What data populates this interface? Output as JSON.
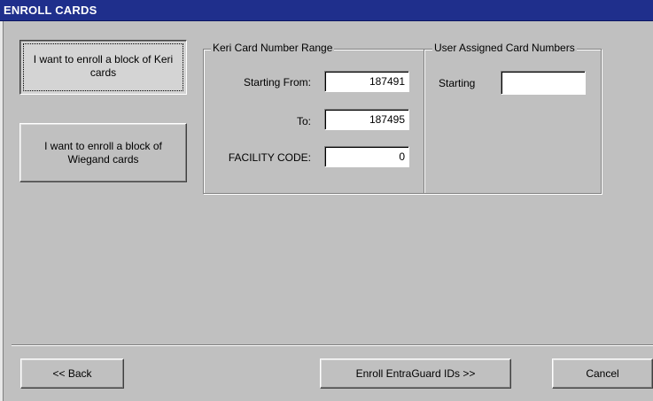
{
  "window": {
    "title": "ENROLL CARDS"
  },
  "options": {
    "keri_button_label": "I want to enroll a block of Keri cards",
    "wiegand_button_label": "I want to enroll a block of Wiegand cards"
  },
  "keri_range": {
    "group_title": "Keri Card Number Range",
    "start_label": "Starting From:",
    "start_value": "187491",
    "to_label": "To:",
    "to_value": "187495",
    "facility_label": "FACILITY CODE:",
    "facility_value": "0"
  },
  "user_assigned": {
    "group_title": "User Assigned Card Numbers",
    "starting_label": "Starting",
    "starting_value": ""
  },
  "footer": {
    "back_label": "<< Back",
    "enroll_label": "Enroll EntraGuard IDs >>",
    "cancel_label": "Cancel"
  }
}
